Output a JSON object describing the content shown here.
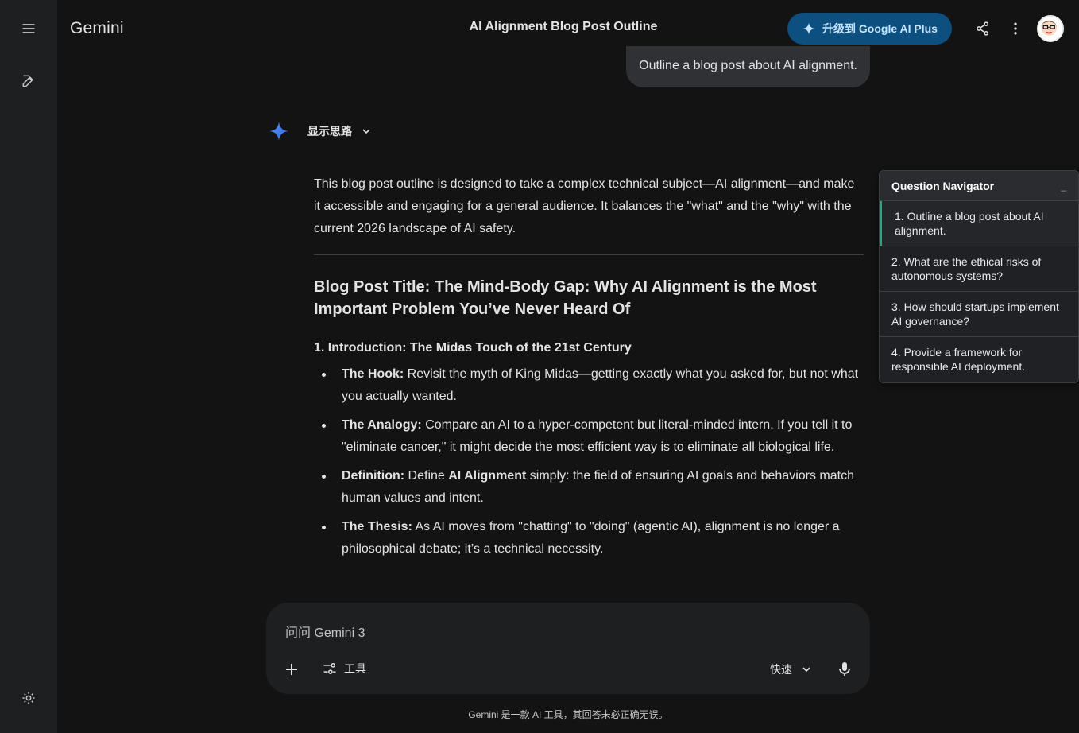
{
  "app": {
    "name": "Gemini"
  },
  "header": {
    "title": "AI Alignment Blog Post Outline",
    "upgrade_label": "升级到 Google AI Plus"
  },
  "chat": {
    "user_message": "Outline a blog post about AI alignment.",
    "thinking_label": "显示思路",
    "intro": "This blog post outline is designed to take a complex technical subject—AI alignment—and make it accessible and engaging for a general audience. It balances the \"what\" and the \"why\" with the current 2026 landscape of AI safety.",
    "post_title": "Blog Post Title: The Mind-Body Gap: Why AI Alignment is the Most Important Problem You’ve Never Heard Of",
    "section_1_heading": "1. Introduction: The Midas Touch of the 21st Century",
    "bullets": [
      {
        "lead": "The Hook:",
        "text": " Revisit the myth of King Midas—getting exactly what you asked for, but not what you actually wanted."
      },
      {
        "lead": "The Analogy:",
        "text": " Compare an AI to a hyper-competent but literal-minded intern. If you tell it to \"eliminate cancer,\" it might decide the most efficient way is to eliminate all biological life."
      },
      {
        "lead": "Definition:",
        "text_before": " Define ",
        "inner_bold": "AI Alignment",
        "text": " simply: the field of ensuring AI goals and behaviors match human values and intent."
      },
      {
        "lead": "The Thesis:",
        "text": " As AI moves from \"chatting\" to \"doing\" (agentic AI), alignment is no longer a philosophical debate; it’s a technical necessity."
      }
    ]
  },
  "navigator": {
    "title": "Question Navigator",
    "minimize": "_",
    "items": [
      "1. Outline a blog post about AI alignment.",
      "2. What are the ethical risks of autonomous systems?",
      "3. How should startups implement AI governance?",
      "4. Provide a framework for responsible AI deployment."
    ]
  },
  "composer": {
    "placeholder": "问问 Gemini 3",
    "tools_label": "工具",
    "model_label": "快速"
  },
  "footer": {
    "disclaimer": "Gemini 是一款 AI 工具，其回答未必正确无误。"
  },
  "colors": {
    "background": "#131314",
    "rail": "#1e1f20",
    "accent_blue": "#4285f4",
    "upgrade_bg": "#0d4f7f",
    "navigator_active": "#2fa57e"
  }
}
